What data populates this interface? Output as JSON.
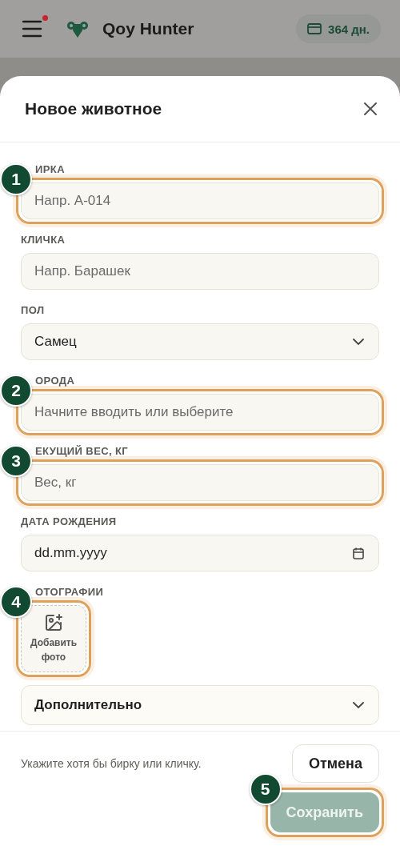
{
  "header": {
    "menu_notification": true,
    "app_name": "Qoy Hunter",
    "subscription": "364 дн."
  },
  "dialog": {
    "title": "Новое животное",
    "fields": [
      {
        "kind": "text",
        "label": "ИРКА",
        "placeholder": "Напр. А-014",
        "step": "1"
      },
      {
        "kind": "text",
        "label": "КЛИЧКА",
        "placeholder": "Напр. Барашек"
      },
      {
        "kind": "select",
        "label": "ПОЛ",
        "value": "Самец"
      },
      {
        "kind": "text",
        "label": "ОРОДА",
        "placeholder": "Начните вводить или выберите",
        "step": "2"
      },
      {
        "kind": "text",
        "label": "ЕКУЩИЙ ВЕС, КГ",
        "placeholder": "Вес, кг",
        "step": "3"
      },
      {
        "kind": "date",
        "label": "ДАТА РОЖДЕНИЯ",
        "value": "dd.mm.yyyy"
      },
      {
        "kind": "photo",
        "label": "ОТОГРАФИИ",
        "button": "Добавить фото",
        "step": "4"
      }
    ],
    "more": {
      "label": "Дополнительно",
      "expanded": false
    },
    "hint": "Укажите хотя бы бирку или кличку.",
    "buttons": [
      {
        "label": "Отмена",
        "kind": "secondary"
      },
      {
        "label": "Сохранить",
        "kind": "primary",
        "disabled": true,
        "step": "5"
      }
    ]
  }
}
